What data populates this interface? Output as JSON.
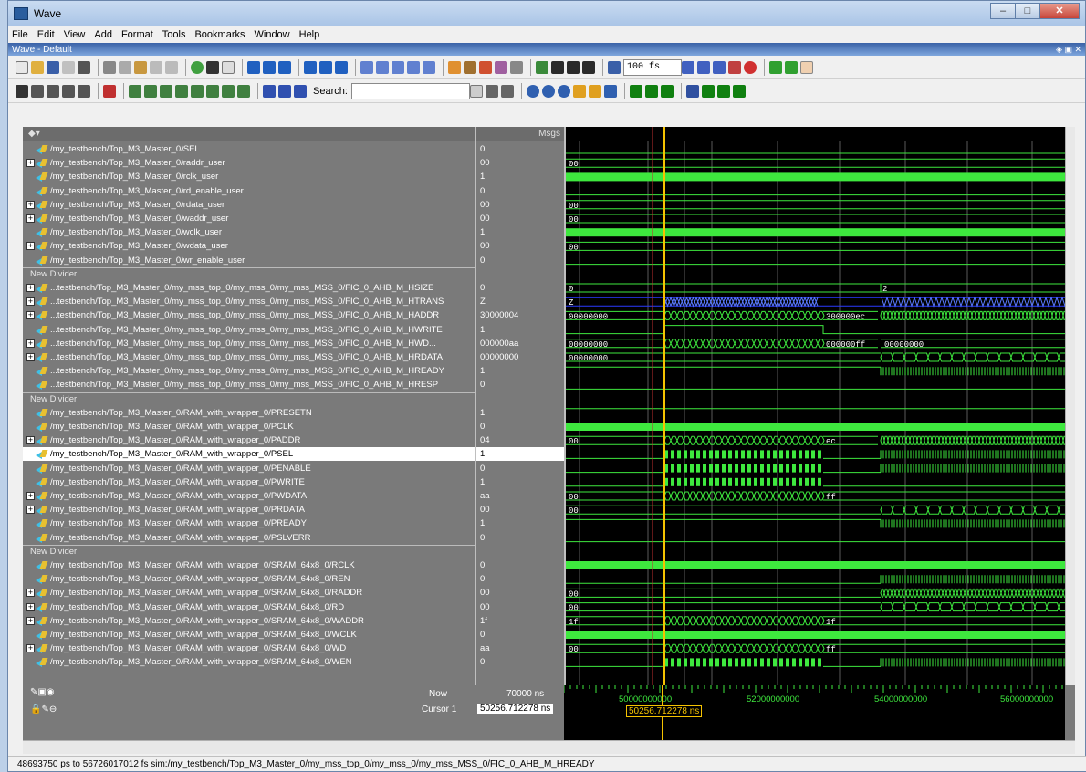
{
  "window": {
    "title": "Wave",
    "subtitle": "Wave - Default"
  },
  "menu": [
    "File",
    "Edit",
    "View",
    "Add",
    "Format",
    "Tools",
    "Bookmarks",
    "Window",
    "Help"
  ],
  "toolbar": {
    "time_step": "100 fs",
    "search_label": "Search:",
    "search_value": ""
  },
  "headers": {
    "values": "Msgs"
  },
  "signals": [
    {
      "name": "/my_testbench/Top_M3_Master_0/SEL",
      "value": "0",
      "expand": false,
      "type": "flat0"
    },
    {
      "name": "/my_testbench/Top_M3_Master_0/raddr_user",
      "value": "00",
      "expand": true,
      "type": "bus",
      "label": "00"
    },
    {
      "name": "/my_testbench/Top_M3_Master_0/rclk_user",
      "value": "1",
      "expand": false,
      "type": "solid"
    },
    {
      "name": "/my_testbench/Top_M3_Master_0/rd_enable_user",
      "value": "0",
      "expand": false,
      "type": "flat0"
    },
    {
      "name": "/my_testbench/Top_M3_Master_0/rdata_user",
      "value": "00",
      "expand": true,
      "type": "bus",
      "label": "00"
    },
    {
      "name": "/my_testbench/Top_M3_Master_0/waddr_user",
      "value": "00",
      "expand": true,
      "type": "bus",
      "label": "00"
    },
    {
      "name": "/my_testbench/Top_M3_Master_0/wclk_user",
      "value": "1",
      "expand": false,
      "type": "solid"
    },
    {
      "name": "/my_testbench/Top_M3_Master_0/wdata_user",
      "value": "00",
      "expand": true,
      "type": "bus",
      "label": "00"
    },
    {
      "name": "/my_testbench/Top_M3_Master_0/wr_enable_user",
      "value": "0",
      "expand": false,
      "type": "flat0"
    },
    {
      "divider": "New Divider"
    },
    {
      "name": "...testbench/Top_M3_Master_0/my_mss_top_0/my_mss_0/my_mss_MSS_0/FIC_0_AHB_M_HSIZE",
      "value": "0",
      "expand": true,
      "type": "bus",
      "label": "0",
      "label2": "2"
    },
    {
      "name": "...testbench/Top_M3_Master_0/my_mss_top_0/my_mss_0/my_mss_MSS_0/FIC_0_AHB_M_HTRANS",
      "value": "Z",
      "expand": true,
      "type": "busblue",
      "label": "Z"
    },
    {
      "name": "...testbench/Top_M3_Master_0/my_mss_top_0/my_mss_0/my_mss_MSS_0/FIC_0_AHB_M_HADDR",
      "value": "30000004",
      "expand": true,
      "type": "busdense",
      "label": "00000000",
      "mid": "300000ec"
    },
    {
      "name": "...testbench/Top_M3_Master_0/my_mss_top_0/my_mss_0/my_mss_MSS_0/FIC_0_AHB_M_HWRITE",
      "value": "1",
      "expand": false,
      "type": "step"
    },
    {
      "name": "...testbench/Top_M3_Master_0/my_mss_top_0/my_mss_0/my_mss_MSS_0/FIC_0_AHB_M_HWD...",
      "value": "000000aa",
      "expand": true,
      "type": "busdense2",
      "label": "00000000",
      "mid": "000000ff",
      "label2": "00000000"
    },
    {
      "name": "...testbench/Top_M3_Master_0/my_mss_top_0/my_mss_0/my_mss_MSS_0/FIC_0_AHB_M_HRDATA",
      "value": "00000000",
      "expand": true,
      "type": "busrd",
      "label": "00000000"
    },
    {
      "name": "...testbench/Top_M3_Master_0/my_mss_top_0/my_mss_0/my_mss_MSS_0/FIC_0_AHB_M_HREADY",
      "value": "1",
      "expand": false,
      "type": "hready"
    },
    {
      "name": "...testbench/Top_M3_Master_0/my_mss_top_0/my_mss_0/my_mss_MSS_0/FIC_0_AHB_M_HRESP",
      "value": "0",
      "expand": false,
      "type": "flat0"
    },
    {
      "divider": "New Divider"
    },
    {
      "name": "/my_testbench/Top_M3_Master_0/RAM_with_wrapper_0/PRESETN",
      "value": "1",
      "expand": false,
      "type": "flat1"
    },
    {
      "name": "/my_testbench/Top_M3_Master_0/RAM_with_wrapper_0/PCLK",
      "value": "0",
      "expand": false,
      "type": "solid"
    },
    {
      "name": "/my_testbench/Top_M3_Master_0/RAM_with_wrapper_0/PADDR",
      "value": "04",
      "expand": true,
      "type": "busdense",
      "label": "00",
      "mid": "ec"
    },
    {
      "name": "/my_testbench/Top_M3_Master_0/RAM_with_wrapper_0/PSEL",
      "value": "1",
      "expand": false,
      "type": "pulses",
      "selected": true
    },
    {
      "name": "/my_testbench/Top_M3_Master_0/RAM_with_wrapper_0/PENABLE",
      "value": "0",
      "expand": false,
      "type": "pulses"
    },
    {
      "name": "/my_testbench/Top_M3_Master_0/RAM_with_wrapper_0/PWRITE",
      "value": "1",
      "expand": false,
      "type": "pulsesw"
    },
    {
      "name": "/my_testbench/Top_M3_Master_0/RAM_with_wrapper_0/PWDATA",
      "value": "aa",
      "expand": true,
      "type": "busw",
      "label": "00",
      "mid": "ff"
    },
    {
      "name": "/my_testbench/Top_M3_Master_0/RAM_with_wrapper_0/PRDATA",
      "value": "00",
      "expand": true,
      "type": "busrd",
      "label": "00"
    },
    {
      "name": "/my_testbench/Top_M3_Master_0/RAM_with_wrapper_0/PREADY",
      "value": "1",
      "expand": false,
      "type": "readypulse"
    },
    {
      "name": "/my_testbench/Top_M3_Master_0/RAM_with_wrapper_0/PSLVERR",
      "value": "0",
      "expand": false,
      "type": "flat0"
    },
    {
      "divider": "New Divider"
    },
    {
      "name": "/my_testbench/Top_M3_Master_0/RAM_with_wrapper_0/SRAM_64x8_0/RCLK",
      "value": "0",
      "expand": false,
      "type": "solid"
    },
    {
      "name": "/my_testbench/Top_M3_Master_0/RAM_with_wrapper_0/SRAM_64x8_0/REN",
      "value": "0",
      "expand": false,
      "type": "rdpulse"
    },
    {
      "name": "/my_testbench/Top_M3_Master_0/RAM_with_wrapper_0/SRAM_64x8_0/RADDR",
      "value": "00",
      "expand": true,
      "type": "busrd2",
      "label": "00"
    },
    {
      "name": "/my_testbench/Top_M3_Master_0/RAM_with_wrapper_0/SRAM_64x8_0/RD",
      "value": "00",
      "expand": true,
      "type": "busrd",
      "label": "00"
    },
    {
      "name": "/my_testbench/Top_M3_Master_0/RAM_with_wrapper_0/SRAM_64x8_0/WADDR",
      "value": "1f",
      "expand": true,
      "type": "busw",
      "label": "1f",
      "mid": "1f"
    },
    {
      "name": "/my_testbench/Top_M3_Master_0/RAM_with_wrapper_0/SRAM_64x8_0/WCLK",
      "value": "0",
      "expand": false,
      "type": "solid"
    },
    {
      "name": "/my_testbench/Top_M3_Master_0/RAM_with_wrapper_0/SRAM_64x8_0/WD",
      "value": "aa",
      "expand": true,
      "type": "busw",
      "label": "00",
      "mid": "ff"
    },
    {
      "name": "/my_testbench/Top_M3_Master_0/RAM_with_wrapper_0/SRAM_64x8_0/WEN",
      "value": "0",
      "expand": false,
      "type": "pulses"
    }
  ],
  "bottom": {
    "now_label": "Now",
    "now_value": "70000 ns",
    "cursor_label": "Cursor 1",
    "cursor_value": "50256.712278 ns",
    "cursor_tag": "50256.712278 ns",
    "ticks": [
      "50000000000",
      "52000000000",
      "54000000000",
      "56000000000"
    ]
  },
  "status": "48693750 ps to 56726017012 fs   sim:/my_testbench/Top_M3_Master_0/my_mss_top_0/my_mss_0/my_mss_MSS_0/FIC_0_AHB_M_HREADY",
  "colors": {
    "wave": "#3ee83e",
    "cursor": "#f5c300",
    "bus_blue": "#2a3aff",
    "background": "#000000"
  }
}
